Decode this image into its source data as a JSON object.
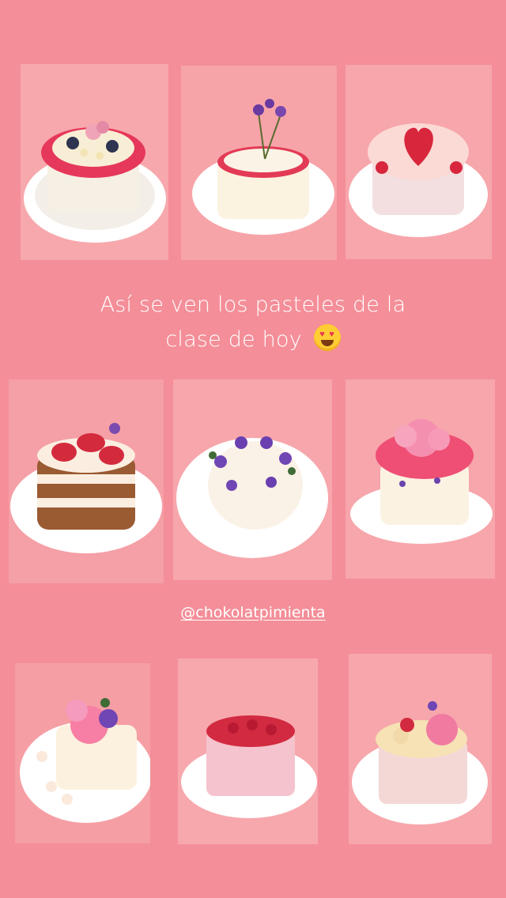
{
  "story": {
    "caption_line1": "Así se ven los pasteles de la",
    "caption_line2": "clase de hoy",
    "caption_emoji": "heart-eyes-emoji",
    "mention": "@chokolatpimienta"
  },
  "colors": {
    "background": "#f48e98",
    "tile": "#f5a1a6",
    "plate": "#ffffff",
    "frosting_red": "#e23a52",
    "cream": "#fbf4e6"
  },
  "photos": [
    {
      "name": "cake-photo-1",
      "cake": "red-frosting-blueberries-flowers"
    },
    {
      "name": "cake-photo-2",
      "cake": "white-cake-red-rim-purple-statice"
    },
    {
      "name": "cake-photo-3",
      "cake": "strawberry-heart-cream"
    },
    {
      "name": "cake-photo-4",
      "cake": "naked-strawberry-layer-cake"
    },
    {
      "name": "cake-photo-5",
      "cake": "purple-flower-wreath-cake"
    },
    {
      "name": "cake-photo-6",
      "cake": "pink-carnation-cake"
    },
    {
      "name": "cake-photo-7",
      "cake": "pink-flower-meringue-cake"
    },
    {
      "name": "cake-photo-8",
      "cake": "strawberry-top-pink-cake"
    },
    {
      "name": "cake-photo-9",
      "cake": "cream-swirl-carnation-cake"
    }
  ]
}
